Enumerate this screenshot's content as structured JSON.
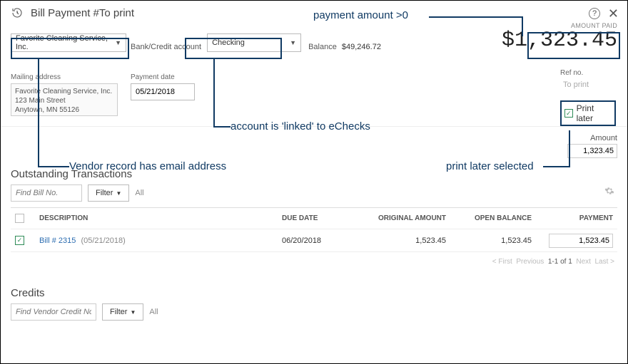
{
  "header": {
    "title": "Bill Payment  #To print"
  },
  "top": {
    "vendor": "Favorite Cleaning Service, Inc.",
    "bank_credit_label": "Bank/Credit account",
    "account": "Checking",
    "balance_label": "Balance",
    "balance_value": "$49,246.72",
    "amount_paid_label": "AMOUNT PAID",
    "amount_paid": "$1,323.45"
  },
  "mid": {
    "mailing_label": "Mailing address",
    "mailing_lines": "Favorite Cleaning Service, Inc.\n123 Main Street\nAnytown, MN  55126",
    "payment_date_label": "Payment date",
    "payment_date": "05/21/2018",
    "ref_label": "Ref no.",
    "ref_value": "To print",
    "print_later_label": "Print later"
  },
  "amount_row": {
    "label": "Amount",
    "value": "1,323.45"
  },
  "outstanding": {
    "title": "Outstanding Transactions",
    "find_placeholder": "Find Bill No.",
    "filter_label": "Filter",
    "all_label": "All",
    "cols": {
      "desc": "DESCRIPTION",
      "due": "DUE DATE",
      "orig": "ORIGINAL AMOUNT",
      "open": "OPEN BALANCE",
      "pay": "PAYMENT"
    },
    "row": {
      "bill_link": "Bill # 2315",
      "bill_date": "(05/21/2018)",
      "due": "06/20/2018",
      "orig": "1,523.45",
      "open": "1,523.45",
      "pay": "1,523.45"
    },
    "pager": {
      "first": "< First",
      "prev": "Previous",
      "range": "1-1 of 1",
      "next": "Next",
      "last": "Last >"
    }
  },
  "credits": {
    "title": "Credits",
    "find_placeholder": "Find Vendor Credit No.",
    "filter_label": "Filter",
    "all_label": "All"
  },
  "annotations": {
    "a1": "payment amount >0",
    "a2": "account is 'linked' to eChecks",
    "a3": "Vendor record has email address",
    "a4": "print later selected"
  }
}
